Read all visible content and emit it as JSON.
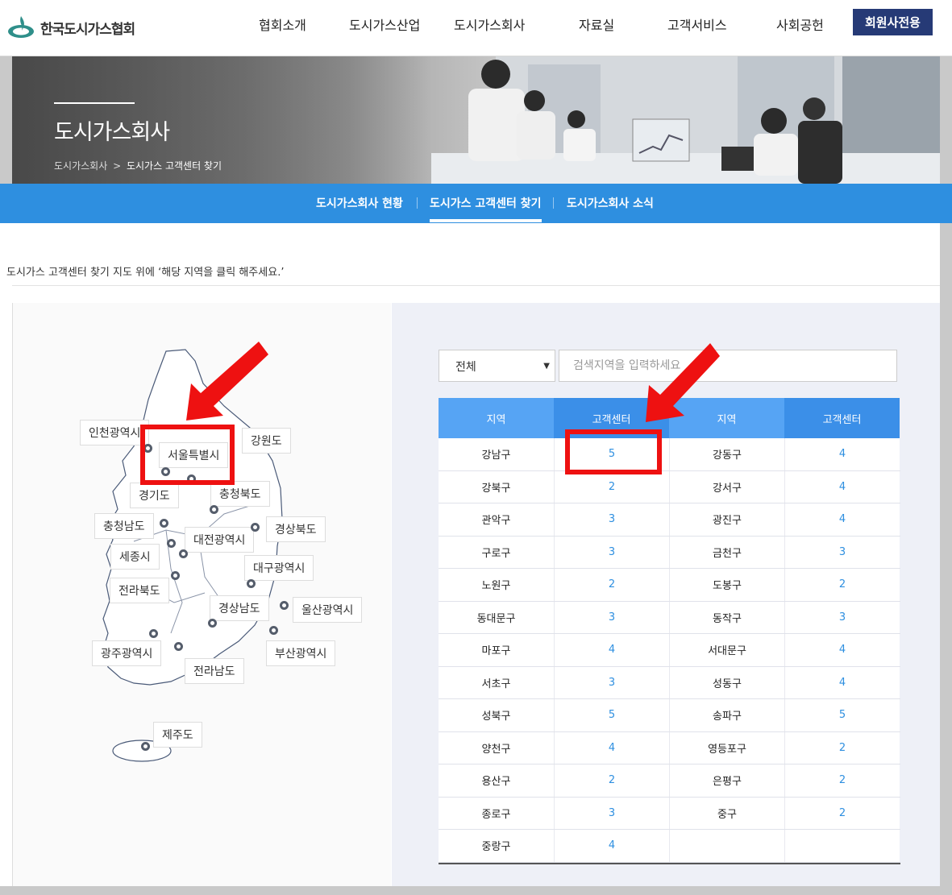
{
  "header": {
    "logo_text": "한국도시가스협회",
    "nav": [
      "협회소개",
      "도시가스산업",
      "도시가스회사",
      "자료실",
      "고객서비스",
      "사회공헌"
    ],
    "member_button": "회원사전용"
  },
  "hero": {
    "title": "도시가스회사",
    "breadcrumb": [
      "도시가스회사",
      "도시가스 고객센터 찾기"
    ]
  },
  "subnav": [
    "도시가스회사 현황",
    "도시가스 고객센터 찾기",
    "도시가스회사 소식"
  ],
  "instruction": "도시가스 고객센터 찾기 지도 위에 ‘해당 지역을 클릭 해주세요.’",
  "search": {
    "select_value": "전체",
    "placeholder": "검색지역을 입력하세요"
  },
  "table": {
    "headers": [
      "지역",
      "고객센터",
      "지역",
      "고객센터"
    ],
    "rows": [
      [
        "강남구",
        "5",
        "강동구",
        "4"
      ],
      [
        "강북구",
        "2",
        "강서구",
        "4"
      ],
      [
        "관악구",
        "3",
        "광진구",
        "4"
      ],
      [
        "구로구",
        "3",
        "금천구",
        "3"
      ],
      [
        "노원구",
        "2",
        "도봉구",
        "2"
      ],
      [
        "동대문구",
        "3",
        "동작구",
        "3"
      ],
      [
        "마포구",
        "4",
        "서대문구",
        "4"
      ],
      [
        "서초구",
        "3",
        "성동구",
        "4"
      ],
      [
        "성북구",
        "5",
        "송파구",
        "5"
      ],
      [
        "양천구",
        "4",
        "영등포구",
        "2"
      ],
      [
        "용산구",
        "2",
        "은평구",
        "2"
      ],
      [
        "종로구",
        "3",
        "중구",
        "2"
      ],
      [
        "중랑구",
        "4",
        "",
        ""
      ]
    ]
  },
  "map_regions": [
    "인천광역시",
    "서울특별시",
    "강원도",
    "경기도",
    "충청북도",
    "충청남도",
    "대전광역시",
    "경상북도",
    "세종시",
    "대구광역시",
    "전라북도",
    "경상남도",
    "울산광역시",
    "광주광역시",
    "부산광역시",
    "전라남도",
    "제주도"
  ],
  "colors": {
    "accent": "#2e8fe0",
    "member_button": "#263a76",
    "annotation": "#ee1111"
  }
}
